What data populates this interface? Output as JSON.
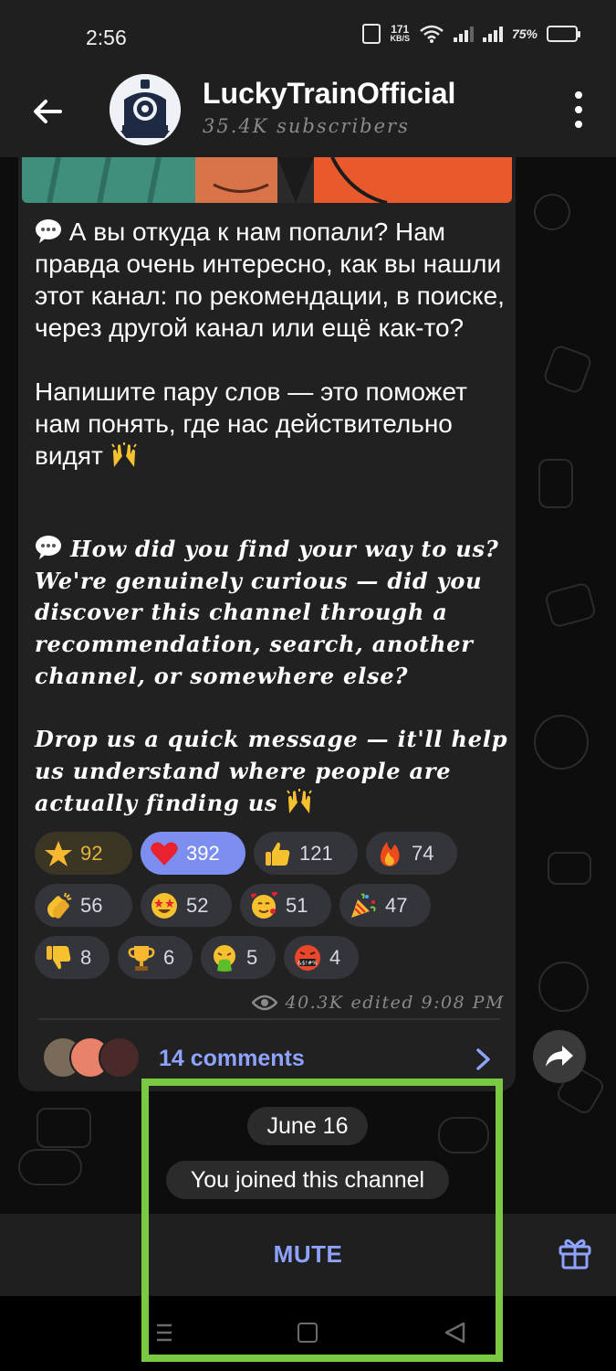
{
  "status_bar": {
    "time": "2:56",
    "net_speed_value": "171",
    "net_speed_unit": "KB/S",
    "battery_percent": "75%",
    "battery_level": 0.75
  },
  "header": {
    "channel_name": "LuckyTrainOfficial",
    "subscribers": "35.4K subscribers",
    "back_icon": "arrow-left-icon",
    "menu_icon": "more-vertical-icon"
  },
  "message": {
    "ru_paragraph_1": "А вы откуда к нам попали? Нам правда очень интересно, как вы нашли этот канал: по рекомендации, в поиске, через другой канал или ещё как-то?",
    "ru_paragraph_2": "Напишите пару слов — это поможет нам понять, где нас действительно видят",
    "en_paragraph_1": "How did you find your way to us? We're genuinely curious — did you discover this channel through a recommendation, search, another channel, or somewhere else?",
    "en_paragraph_2": "Drop us a quick message — it'll help us understand where people are actually finding us",
    "views": "40.3K",
    "edited": "edited 9:08 PM",
    "comments_label": "14 comments"
  },
  "reactions": [
    [
      {
        "icon": "star-icon",
        "count": "92"
      },
      {
        "icon": "red-heart-icon",
        "count": "392"
      },
      {
        "icon": "thumbs-up-icon",
        "count": "121"
      },
      {
        "icon": "fire-icon",
        "count": "74"
      }
    ],
    [
      {
        "icon": "clapping-hands-icon",
        "count": "56"
      },
      {
        "icon": "star-struck-icon",
        "count": "52"
      },
      {
        "icon": "smiling-hearts-icon",
        "count": "51"
      },
      {
        "icon": "party-popper-icon",
        "count": "47"
      }
    ],
    [
      {
        "icon": "thumbs-down-icon",
        "count": "8"
      },
      {
        "icon": "trophy-icon",
        "count": "6"
      },
      {
        "icon": "vomiting-face-icon",
        "count": "5"
      },
      {
        "icon": "cursing-face-icon",
        "count": "4"
      }
    ]
  ],
  "service": {
    "date": "June 16",
    "joined": "You joined this channel"
  },
  "bottom_bar": {
    "mute_label": "MUTE",
    "gift_icon": "gift-icon"
  },
  "colors": {
    "accent": "#8ea2ff",
    "active_reaction": "#7c8ff0",
    "highlight": "#7ac943",
    "bubble": "#212121"
  }
}
